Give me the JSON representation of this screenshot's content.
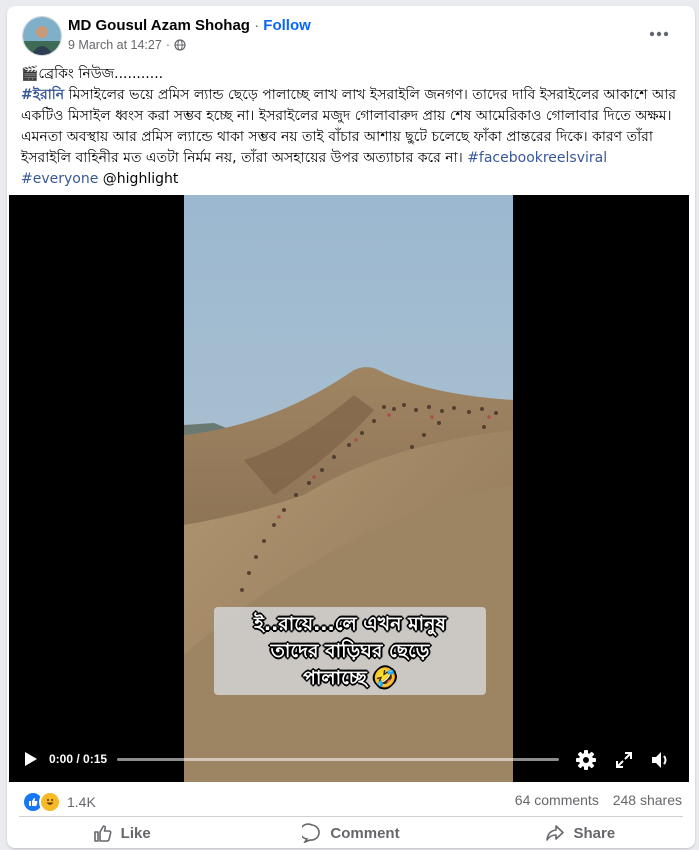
{
  "post": {
    "author": "MD Gousul Azam Shohag",
    "separator": "·",
    "follow_label": "Follow",
    "timestamp": "9 March at 14:27",
    "meta_separator": "·",
    "more_icon": "ellipsis-icon",
    "privacy_icon": "globe-icon"
  },
  "text": {
    "line1": "🎬ব্রেকিং নিউজ...........",
    "tag1": "#ইরানি",
    "body": " মিসাইলের ভয়ে প্রমিস ল্যান্ড  ছেড়ে পালাচ্ছে লাখ লাখ ইসরাইলি জনগণ। তাদের দাবি ইসরাইলের আকাশে আর একটিও মিসাইল ধ্বংস করা সম্ভব হচ্ছে না। ইসরাইলের মজুদ গোলাবারুদ প্রায় শেষ আমেরিকাও গোলাবার দিতে অক্ষম।এমনতা অবস্থায় আর প্রমিস ল্যান্ডে থাকা সম্ভব নয় তাই বাঁচার আশায় ছুটে চলেছে ফাঁকা প্রান্তরের দিকে। কারণ তাঁরা ইসরাইলি বাহিনীর মত এতটা নির্মম নয়, তাঁরা অসহায়ের উপর অত্যাচার করে না। ",
    "tag2": "#facebookreelsviral",
    "tag3": "#everyone",
    "mention": "@highlight"
  },
  "video": {
    "caption_line1": "ই..রায়ে...লে এখন মানুষ",
    "caption_line2": "তাদের বাড়িঘর ছেড়ে",
    "caption_line3": "পালাচ্ছে 🤣",
    "time": "0:00 / 0:15",
    "progress": 0,
    "icons": [
      "play-icon",
      "settings-icon",
      "fullscreen-icon",
      "volume-icon"
    ]
  },
  "stats": {
    "reaction_count": "1.4K",
    "comments": "64 comments",
    "shares": "248 shares",
    "reaction_icons": [
      "like-reaction-icon",
      "haha-reaction-icon"
    ]
  },
  "actions": {
    "like": "Like",
    "comment": "Comment",
    "share": "Share"
  },
  "colors": {
    "link": "#0866ff",
    "hashtag": "#385898",
    "like_blue": "#1877f2",
    "haha_yellow": "#f7b928",
    "muted": "#65676b"
  }
}
